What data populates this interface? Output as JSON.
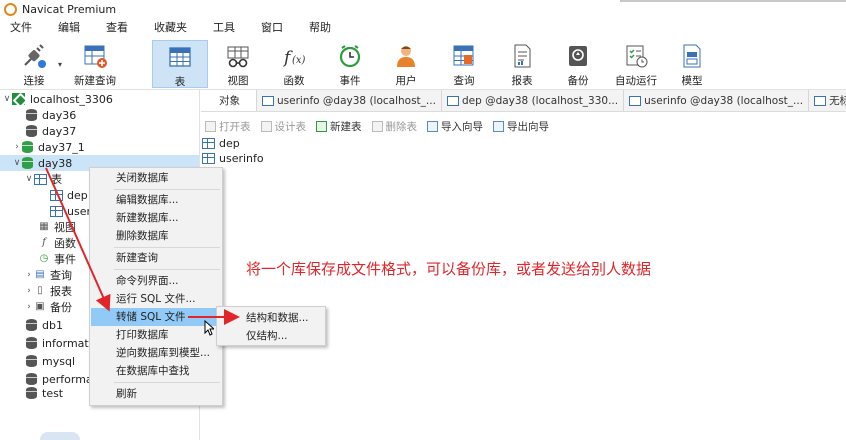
{
  "window": {
    "title": "Navicat Premium"
  },
  "menubar": [
    "文件",
    "编辑",
    "查看",
    "收藏夹",
    "工具",
    "窗口",
    "帮助"
  ],
  "toolbar": {
    "buttons": [
      {
        "label": "连接",
        "icon": "plug-icon"
      },
      {
        "label": "新建查询",
        "icon": "new-query-icon"
      },
      {
        "label": "表",
        "icon": "table-icon",
        "active": true
      },
      {
        "label": "视图",
        "icon": "view-icon"
      },
      {
        "label": "函数",
        "icon": "function-icon"
      },
      {
        "label": "事件",
        "icon": "clock-icon"
      },
      {
        "label": "用户",
        "icon": "user-icon"
      },
      {
        "label": "查询",
        "icon": "query-icon"
      },
      {
        "label": "报表",
        "icon": "report-icon"
      },
      {
        "label": "备份",
        "icon": "backup-icon"
      },
      {
        "label": "自动运行",
        "icon": "schedule-icon"
      },
      {
        "label": "模型",
        "icon": "model-icon"
      }
    ]
  },
  "tree": {
    "connection": "localhost_3306",
    "databases": [
      "day36",
      "day37",
      "day37_1",
      "day38"
    ],
    "day38_children": {
      "tables_folder": "表",
      "tables": [
        "dep",
        "user"
      ],
      "others": [
        "视图",
        "函数",
        "事件",
        "查询",
        "报表",
        "备份"
      ]
    },
    "more_databases": [
      "db1",
      "informati",
      "mysql",
      "performa",
      "test"
    ]
  },
  "tabs": [
    "对象",
    "userinfo @day38 (localhost_...",
    "dep @day38 (localhost_330...",
    "userinfo @day38 (localhost_...",
    "无标题 @day38 (lo"
  ],
  "object_toolbar": {
    "open": "打开表",
    "design": "设计表",
    "new": "新建表",
    "delete": "删除表",
    "import": "导入向导",
    "export": "导出向导"
  },
  "objects": [
    "dep",
    "userinfo"
  ],
  "context_menu": [
    "关闭数据库",
    "编辑数据库...",
    "新建数据库...",
    "删除数据库",
    "新建查询",
    "命令列界面...",
    "运行 SQL 文件...",
    "转储 SQL 文件",
    "打印数据库",
    "逆向数据库到模型...",
    "在数据库中查找",
    "刷新"
  ],
  "submenu": [
    "结构和数据...",
    "仅结构..."
  ],
  "annotation": "将一个库保存成文件格式，可以备份库，或者发送给别人数据",
  "colors": {
    "accent_red": "#e0262b",
    "highlight_blue": "#91c9f7",
    "selected_blue": "#cce4f7"
  }
}
